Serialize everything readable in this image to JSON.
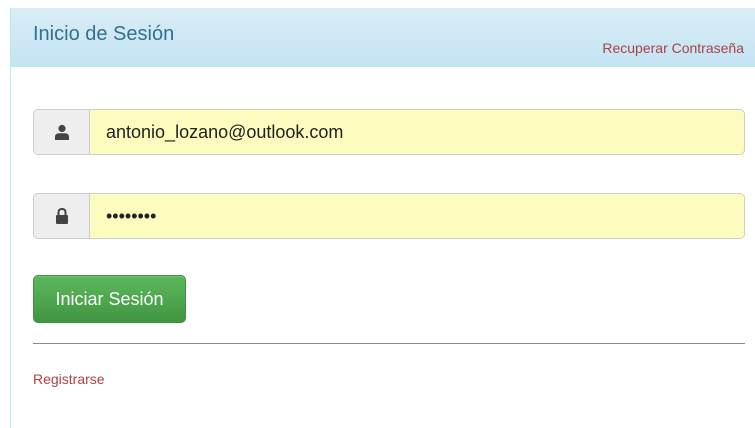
{
  "header": {
    "title": "Inicio de Sesión",
    "recover_link": "Recuperar Contraseña"
  },
  "form": {
    "email": {
      "icon": "user-icon",
      "value": "antonio_lozano@outlook.com"
    },
    "password": {
      "icon": "lock-icon",
      "value": "password"
    },
    "submit_label": "Iniciar Sesión"
  },
  "footer": {
    "register_link": "Registrarse"
  },
  "colors": {
    "heading_bg": "#d9edf7",
    "heading_text": "#31708f",
    "link": "#a94442",
    "input_bg": "#fbfcbd",
    "button": "#5cb85c"
  }
}
